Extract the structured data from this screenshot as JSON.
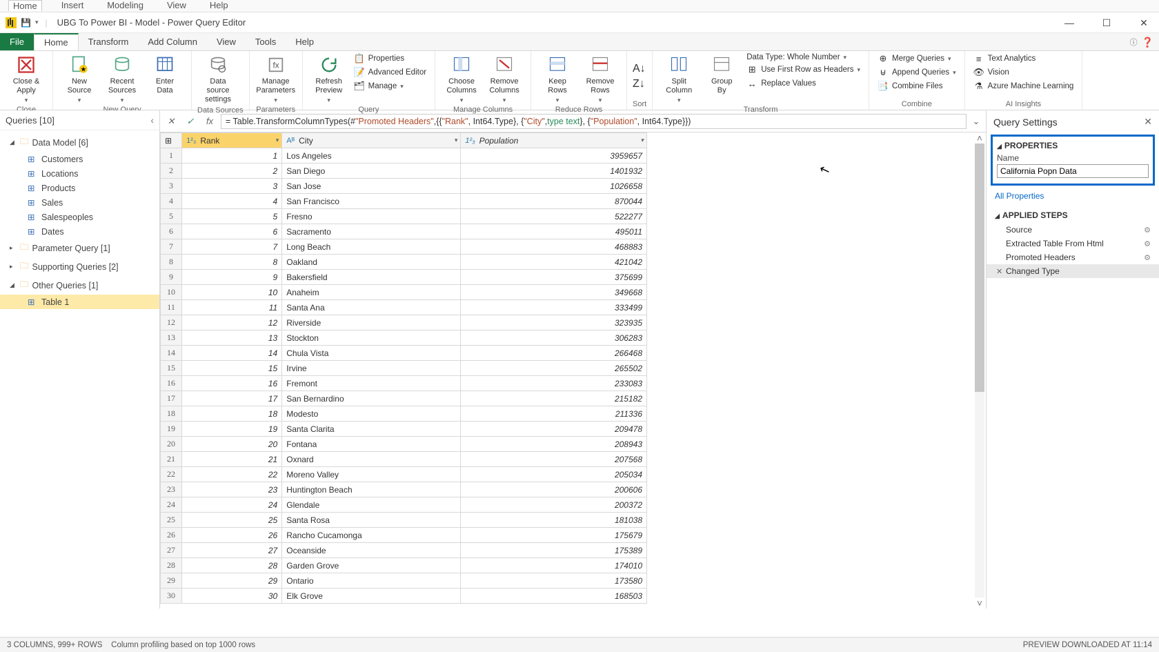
{
  "outer_menu": {
    "home": "Home",
    "insert": "Insert",
    "modeling": "Modeling",
    "view": "View",
    "help": "Help"
  },
  "title": "UBG To Power BI - Model - Power Query Editor",
  "menubar": {
    "file": "File",
    "home": "Home",
    "transform": "Transform",
    "addcol": "Add Column",
    "view": "View",
    "tools": "Tools",
    "help": "Help"
  },
  "ribbon": {
    "close": {
      "close_apply": "Close &\nApply",
      "group": "Close"
    },
    "newquery": {
      "new_source": "New\nSource",
      "recent_sources": "Recent\nSources",
      "enter_data": "Enter\nData",
      "group": "New Query"
    },
    "datasources": {
      "ds_settings": "Data source\nsettings",
      "group": "Data Sources"
    },
    "parameters": {
      "manage_params": "Manage\nParameters",
      "group": "Parameters"
    },
    "query": {
      "refresh": "Refresh\nPreview",
      "properties": "Properties",
      "adv_editor": "Advanced Editor",
      "manage": "Manage",
      "group": "Query"
    },
    "manage_cols": {
      "choose": "Choose\nColumns",
      "remove": "Remove\nColumns",
      "group": "Manage Columns"
    },
    "reduce": {
      "keep": "Keep\nRows",
      "remove": "Remove\nRows",
      "group": "Reduce Rows"
    },
    "sort": {
      "group": "Sort"
    },
    "transform": {
      "split": "Split\nColumn",
      "groupby": "Group\nBy",
      "datatype": "Data Type: Whole Number",
      "firstrow": "Use First Row as Headers",
      "replace": "Replace Values",
      "group": "Transform"
    },
    "combine": {
      "merge": "Merge Queries",
      "append": "Append Queries",
      "combine_files": "Combine Files",
      "group": "Combine"
    },
    "ai": {
      "text": "Text Analytics",
      "vision": "Vision",
      "azml": "Azure Machine Learning",
      "group": "AI Insights"
    }
  },
  "queries_panel": {
    "title": "Queries [10]",
    "groups": [
      {
        "label": "Data Model [6]",
        "expanded": true,
        "items": [
          "Customers",
          "Locations",
          "Products",
          "Sales",
          "Salespeoples",
          "Dates"
        ]
      },
      {
        "label": "Parameter Query [1]",
        "expanded": false
      },
      {
        "label": "Supporting Queries [2]",
        "expanded": false
      },
      {
        "label": "Other Queries [1]",
        "expanded": true,
        "items": [
          "Table 1"
        ],
        "selected": "Table 1"
      }
    ]
  },
  "formula": {
    "prefix": "= Table.TransformColumnTypes(#",
    "p1": "\"Promoted Headers\"",
    "mid": ",{{",
    "s1": "\"Rank\"",
    "t1": ", Int64.Type}, {",
    "s2": "\"City\"",
    "t2": ", ",
    "ty2": "type text",
    "t3": "}, {",
    "s3": "\"Population\"",
    "t4": ", Int64.Type}})"
  },
  "columns": {
    "rank": "Rank",
    "city": "City",
    "pop": "Population"
  },
  "rows": [
    {
      "n": 1,
      "rank": 1,
      "city": "Los Angeles",
      "pop": 3959657
    },
    {
      "n": 2,
      "rank": 2,
      "city": "San Diego",
      "pop": 1401932
    },
    {
      "n": 3,
      "rank": 3,
      "city": "San Jose",
      "pop": 1026658
    },
    {
      "n": 4,
      "rank": 4,
      "city": "San Francisco",
      "pop": 870044
    },
    {
      "n": 5,
      "rank": 5,
      "city": "Fresno",
      "pop": 522277
    },
    {
      "n": 6,
      "rank": 6,
      "city": "Sacramento",
      "pop": 495011
    },
    {
      "n": 7,
      "rank": 7,
      "city": "Long Beach",
      "pop": 468883
    },
    {
      "n": 8,
      "rank": 8,
      "city": "Oakland",
      "pop": 421042
    },
    {
      "n": 9,
      "rank": 9,
      "city": "Bakersfield",
      "pop": 375699
    },
    {
      "n": 10,
      "rank": 10,
      "city": "Anaheim",
      "pop": 349668
    },
    {
      "n": 11,
      "rank": 11,
      "city": "Santa Ana",
      "pop": 333499
    },
    {
      "n": 12,
      "rank": 12,
      "city": "Riverside",
      "pop": 323935
    },
    {
      "n": 13,
      "rank": 13,
      "city": "Stockton",
      "pop": 306283
    },
    {
      "n": 14,
      "rank": 14,
      "city": "Chula Vista",
      "pop": 266468
    },
    {
      "n": 15,
      "rank": 15,
      "city": "Irvine",
      "pop": 265502
    },
    {
      "n": 16,
      "rank": 16,
      "city": "Fremont",
      "pop": 233083
    },
    {
      "n": 17,
      "rank": 17,
      "city": "San Bernardino",
      "pop": 215182
    },
    {
      "n": 18,
      "rank": 18,
      "city": "Modesto",
      "pop": 211336
    },
    {
      "n": 19,
      "rank": 19,
      "city": "Santa Clarita",
      "pop": 209478
    },
    {
      "n": 20,
      "rank": 20,
      "city": "Fontana",
      "pop": 208943
    },
    {
      "n": 21,
      "rank": 21,
      "city": "Oxnard",
      "pop": 207568
    },
    {
      "n": 22,
      "rank": 22,
      "city": "Moreno Valley",
      "pop": 205034
    },
    {
      "n": 23,
      "rank": 23,
      "city": "Huntington Beach",
      "pop": 200606
    },
    {
      "n": 24,
      "rank": 24,
      "city": "Glendale",
      "pop": 200372
    },
    {
      "n": 25,
      "rank": 25,
      "city": "Santa Rosa",
      "pop": 181038
    },
    {
      "n": 26,
      "rank": 26,
      "city": "Rancho Cucamonga",
      "pop": 175679
    },
    {
      "n": 27,
      "rank": 27,
      "city": "Oceanside",
      "pop": 175389
    },
    {
      "n": 28,
      "rank": 28,
      "city": "Garden Grove",
      "pop": 174010
    },
    {
      "n": 29,
      "rank": 29,
      "city": "Ontario",
      "pop": 173580
    },
    {
      "n": 30,
      "rank": 30,
      "city": "Elk Grove",
      "pop": 168503
    }
  ],
  "settings": {
    "title": "Query Settings",
    "properties": "PROPERTIES",
    "name_label": "Name",
    "name_value": "California Popn Data",
    "all_props": "All Properties",
    "applied_steps": "APPLIED STEPS",
    "steps": [
      {
        "label": "Source",
        "gear": true
      },
      {
        "label": "Extracted Table From Html",
        "gear": true
      },
      {
        "label": "Promoted Headers",
        "gear": true
      },
      {
        "label": "Changed Type",
        "gear": false,
        "selected": true,
        "x": true
      }
    ]
  },
  "status": {
    "left1": "3 COLUMNS, 999+ ROWS",
    "left2": "Column profiling based on top 1000 rows",
    "right": "PREVIEW DOWNLOADED AT 11:14"
  }
}
